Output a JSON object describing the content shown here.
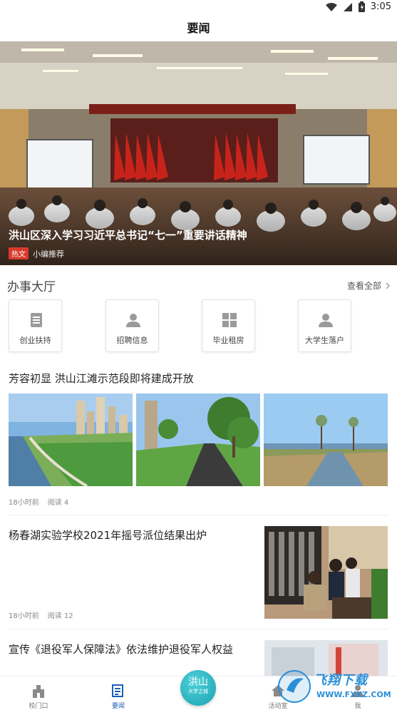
{
  "status_bar": {
    "time": "3:05"
  },
  "header": {
    "title": "要闻"
  },
  "hero": {
    "title": "洪山区深入学习习近平总书记“七一”重要讲话精神",
    "tag": "热文",
    "source": "小编推荐"
  },
  "service_hall": {
    "title": "办事大厅",
    "view_all": "查看全部",
    "items": [
      {
        "label": "创业扶持",
        "icon": "document-icon"
      },
      {
        "label": "招聘信息",
        "icon": "person-icon"
      },
      {
        "label": "毕业租房",
        "icon": "grid-icon"
      },
      {
        "label": "大学生落户",
        "icon": "person-icon"
      }
    ]
  },
  "articles": [
    {
      "title": "芳容初显 洪山江滩示范段即将建成开放",
      "time": "18小时前",
      "reads": "阅读 4"
    },
    {
      "title": "杨春湖实验学校2021年摇号派位结果出炉",
      "time": "18小时前",
      "reads": "阅读 12"
    },
    {
      "title": "宣传《退役军人保障法》依法维护退役军人权益"
    }
  ],
  "bottom_nav": {
    "items": [
      {
        "label": "校门口",
        "icon": "building-icon"
      },
      {
        "label": "要闻",
        "icon": "news-icon",
        "active": true
      },
      {
        "label": "活动室",
        "icon": "home-icon"
      },
      {
        "label": "我",
        "icon": "user-icon"
      }
    ],
    "center_badge": {
      "line1": "洪山",
      "line2": "大学之城"
    }
  },
  "watermark": {
    "text": "飞翔下载",
    "url": "WWW.FXXZ.COM"
  },
  "colors": {
    "accent": "#1c5fb8",
    "hot_tag": "#d93a2b",
    "badge": "#1aa3b3"
  }
}
